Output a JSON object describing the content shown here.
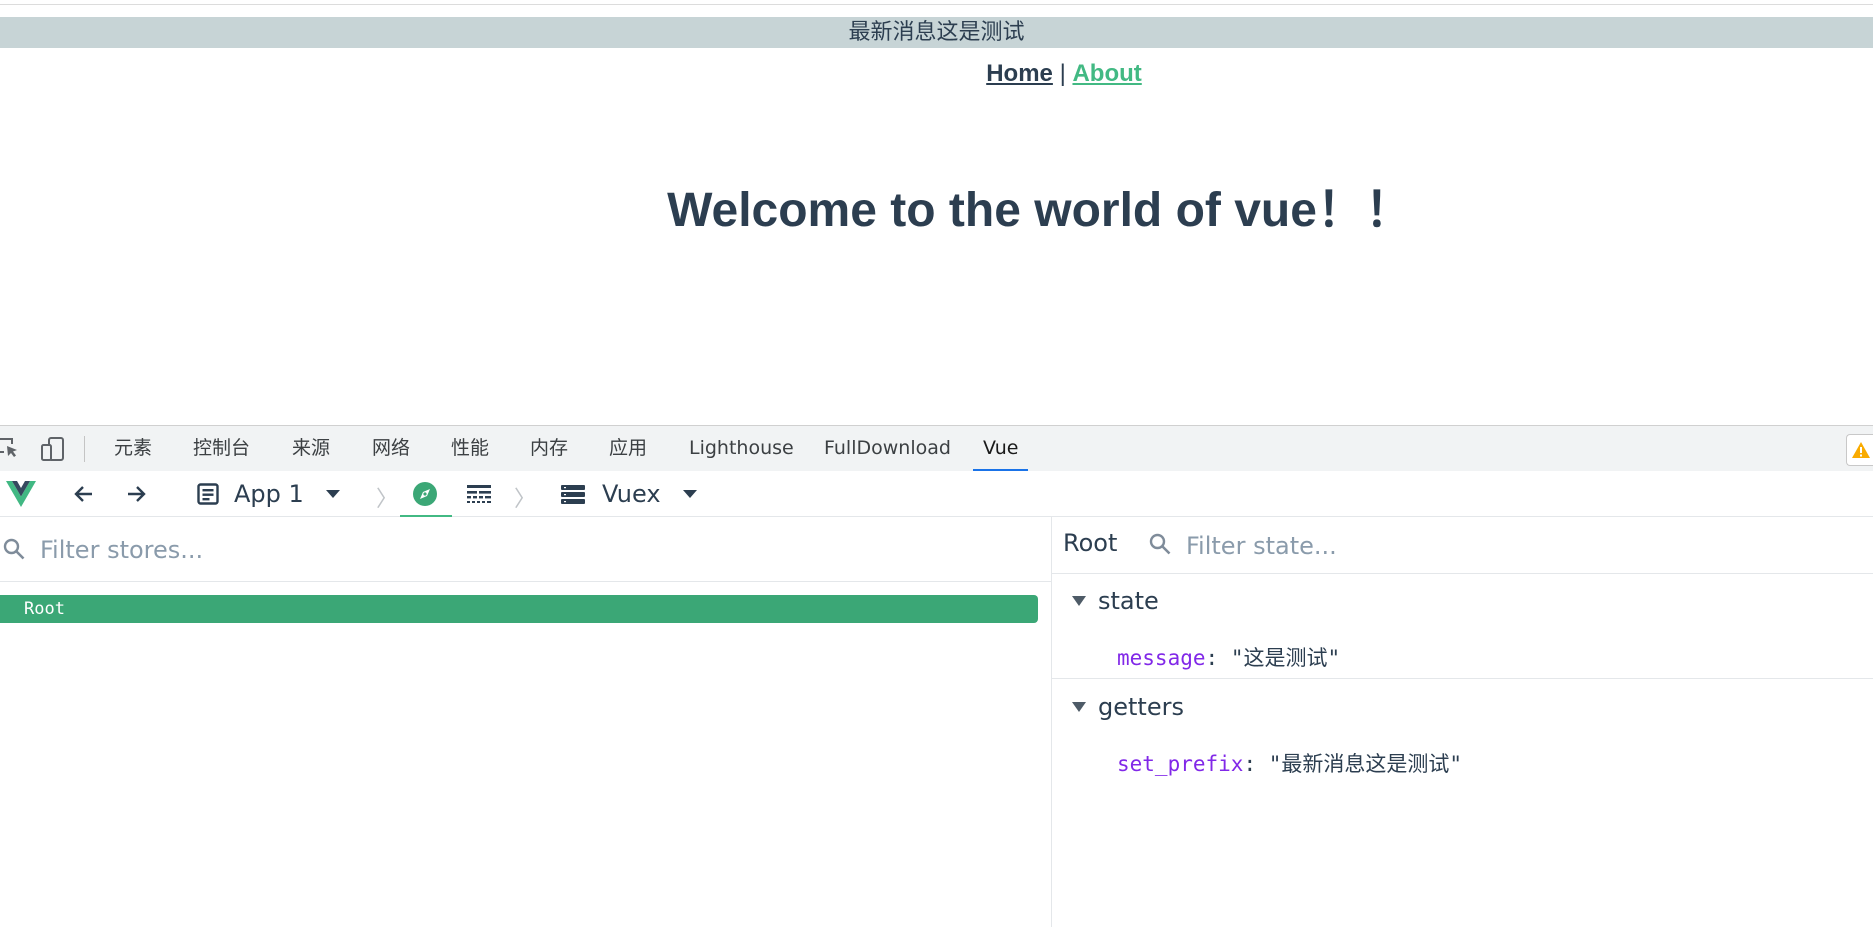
{
  "page": {
    "banner_text": "最新消息这是测试",
    "nav": {
      "home": "Home",
      "separator": "|",
      "about": "About"
    },
    "welcome": "Welcome to the world of vue！！"
  },
  "devtools": {
    "tabs": [
      {
        "label": "元素"
      },
      {
        "label": "控制台"
      },
      {
        "label": "来源"
      },
      {
        "label": "网络"
      },
      {
        "label": "性能"
      },
      {
        "label": "内存"
      },
      {
        "label": "应用"
      },
      {
        "label": "Lighthouse"
      },
      {
        "label": "FullDownload"
      },
      {
        "label": "Vue",
        "active": true
      }
    ],
    "accent_color": "#1a73e8",
    "warning_color": "#f9ab00"
  },
  "vue": {
    "accent_color": "#42b983",
    "app_selector": "App 1",
    "plugin_selector": "Vuex",
    "left": {
      "filter_placeholder": "Filter stores...",
      "selected_store": "Root"
    },
    "right": {
      "root_label": "Root",
      "filter_placeholder": "Filter state...",
      "sections": [
        {
          "label": "state",
          "key": "message",
          "value": "\"这是测试\""
        },
        {
          "label": "getters",
          "key": "set_prefix",
          "value": "\"最新消息这是测试\""
        }
      ]
    },
    "icons": [
      "vue-logo-icon",
      "back-arrow-icon",
      "forward-arrow-icon",
      "app-icon",
      "dropdown-icon",
      "compass-icon",
      "timeline-icon",
      "list-icon",
      "search-icon"
    ]
  }
}
